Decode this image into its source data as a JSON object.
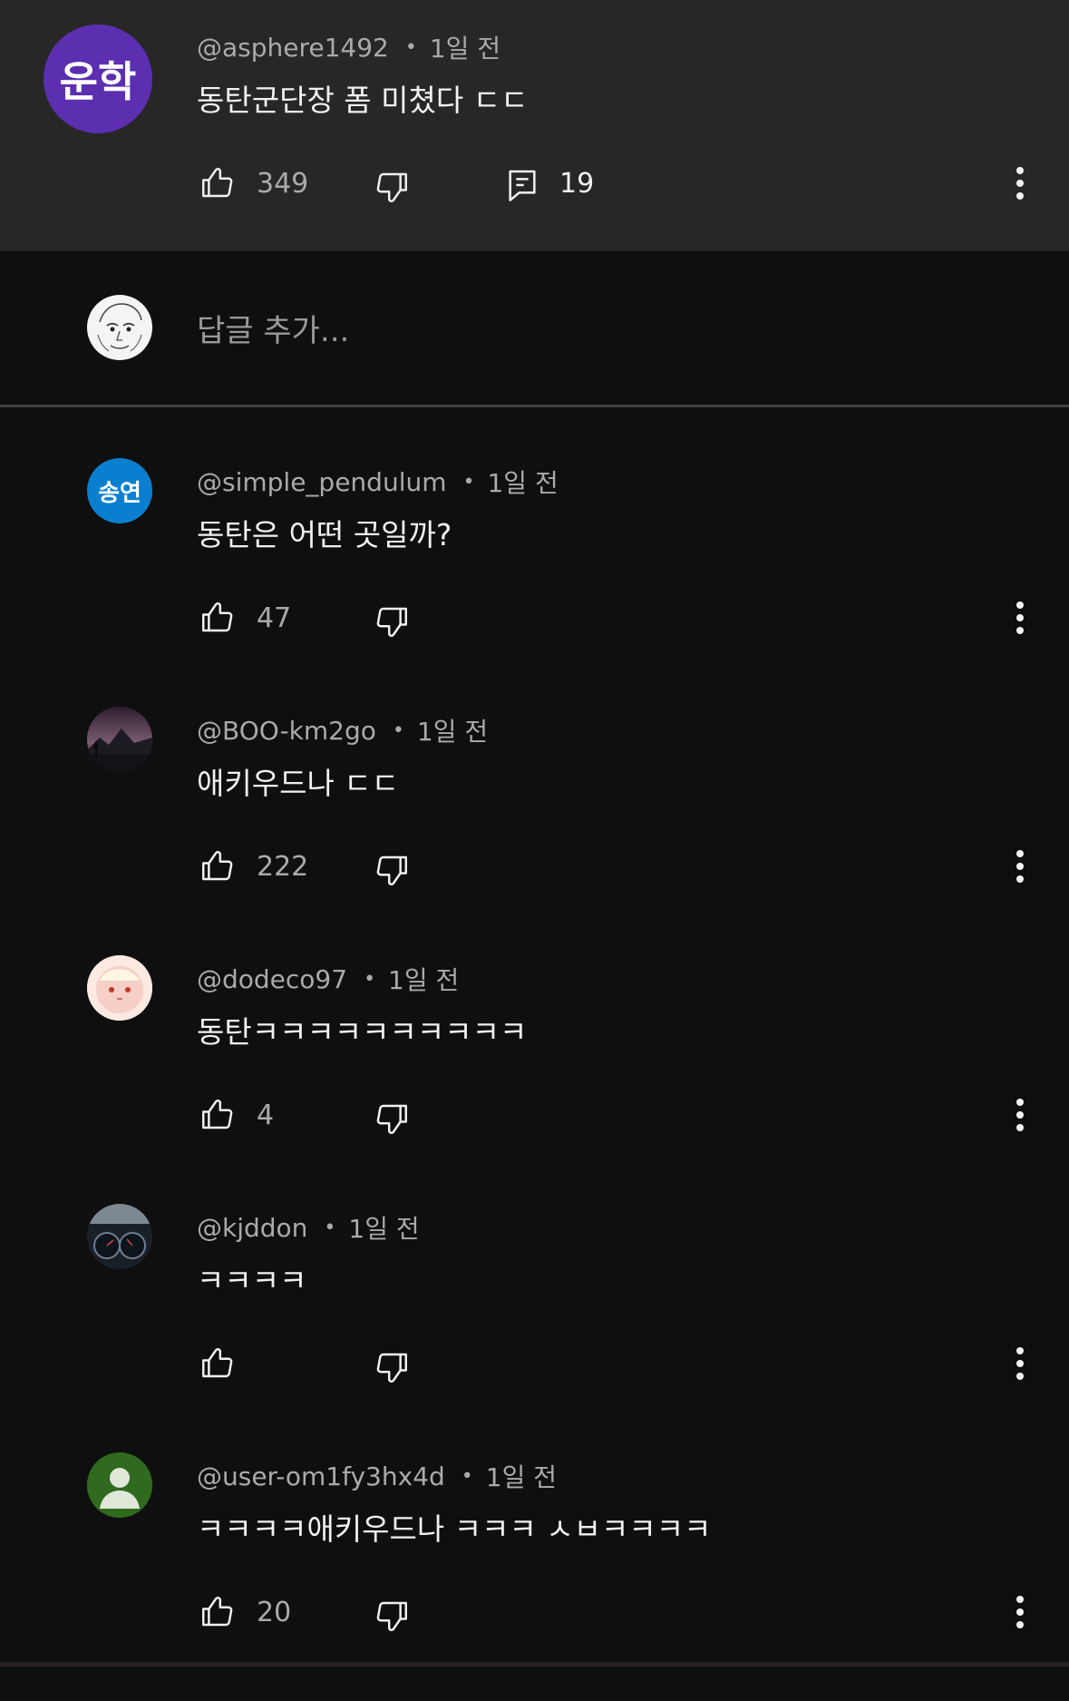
{
  "top_comment": {
    "avatar_text": "운학",
    "avatar_color": "#5b2fb0",
    "handle": "@asphere1492",
    "time": "1일 전",
    "text": "동탄군단장 폼 미쳤다 ㄷㄷ",
    "likes": "349",
    "replies_count": "19"
  },
  "reply_box": {
    "placeholder": "답글 추가..."
  },
  "replies": [
    {
      "handle": "@simple_pendulum",
      "time": "1일 전",
      "text": "동탄은 어떤 곳일까?",
      "likes": "47",
      "avatar_text": "송연",
      "avatar_color": "#0a7fd0"
    },
    {
      "handle": "@BOO-km2go",
      "time": "1일 전",
      "text": "애키우드나 ㄷㄷ",
      "likes": "222",
      "avatar_text": "",
      "avatar_color": "#4a3a4a"
    },
    {
      "handle": "@dodeco97",
      "time": "1일 전",
      "text": "동탄ㅋㅋㅋㅋㅋㅋㅋㅋㅋㅋ",
      "likes": "4",
      "avatar_text": "",
      "avatar_color": "#f3d6cf"
    },
    {
      "handle": "@kjddon",
      "time": "1일 전",
      "text": "ㅋㅋㅋㅋ",
      "likes": "",
      "avatar_text": "",
      "avatar_color": "#1c2530"
    },
    {
      "handle": "@user-om1fy3hx4d",
      "time": "1일 전",
      "text": "ㅋㅋㅋㅋ애키우드나 ㅋㅋㅋ ㅅㅂㅋㅋㅋㅋ",
      "likes": "20",
      "avatar_text": "",
      "avatar_color": "#2f6a1f"
    }
  ]
}
